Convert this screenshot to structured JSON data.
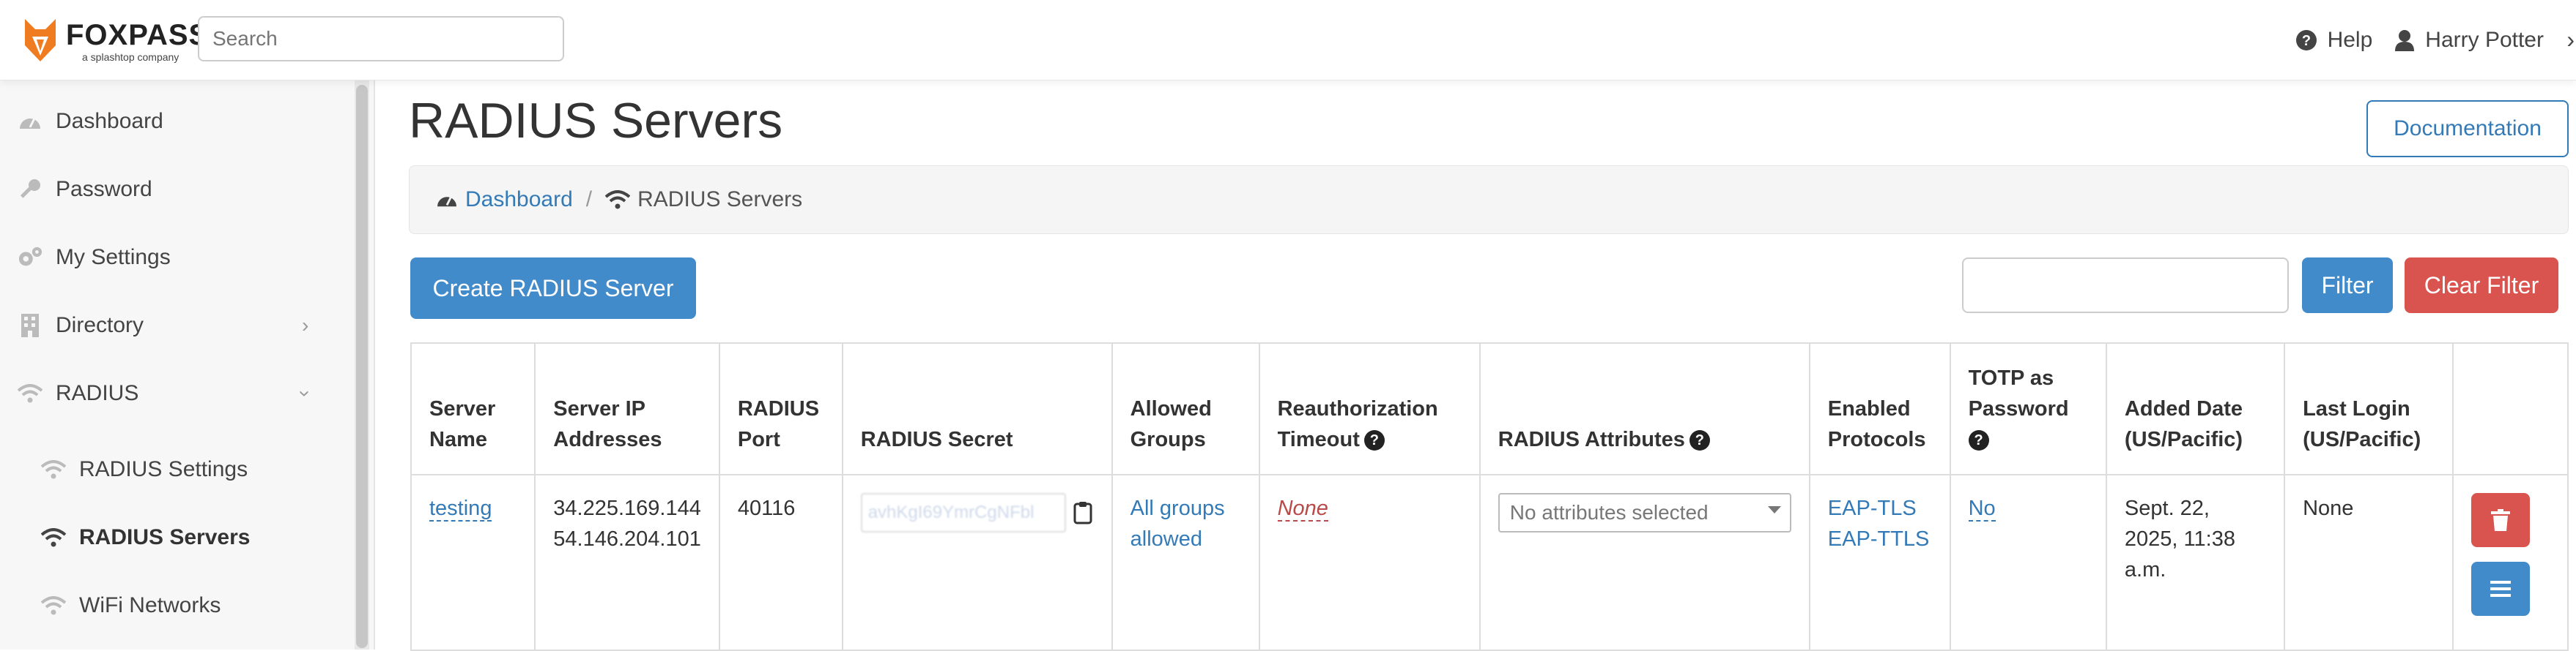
{
  "header": {
    "logo_text": "FOXPASS",
    "logo_subtext": "a splashtop company",
    "search_placeholder": "Search",
    "help_label": "Help",
    "user_name": "Harry Potter"
  },
  "sidebar": {
    "items": [
      {
        "label": "Dashboard",
        "icon": "dashboard-icon"
      },
      {
        "label": "Password",
        "icon": "key-icon"
      },
      {
        "label": "My Settings",
        "icon": "gears-icon"
      },
      {
        "label": "Directory",
        "icon": "building-icon"
      },
      {
        "label": "RADIUS",
        "icon": "wifi-icon"
      },
      {
        "label": "RADIUS Settings",
        "icon": "wifi-icon"
      },
      {
        "label": "RADIUS Servers",
        "icon": "wifi-icon"
      },
      {
        "label": "WiFi Networks",
        "icon": "wifi-icon"
      }
    ]
  },
  "main": {
    "title": "RADIUS Servers",
    "documentation_label": "Documentation",
    "breadcrumb": {
      "home": "Dashboard",
      "separator": "/",
      "current": "RADIUS Servers"
    },
    "create_label": "Create RADIUS Server",
    "filter_label": "Filter",
    "clear_filter_label": "Clear Filter",
    "table": {
      "headers": {
        "server_name": [
          "Server",
          "Name"
        ],
        "server_ip": [
          "Server IP",
          "Addresses"
        ],
        "port": [
          "RADIUS",
          "Port"
        ],
        "secret": "RADIUS Secret",
        "groups": [
          "Allowed",
          "Groups"
        ],
        "reauth": [
          "Reauthorization",
          "Timeout"
        ],
        "attributes": "RADIUS Attributes",
        "protocols": [
          "Enabled",
          "Protocols"
        ],
        "totp": [
          "TOTP as",
          "Password"
        ],
        "added": [
          "Added Date",
          "(US/Pacific)"
        ],
        "last_login": [
          "Last Login",
          "(US/Pacific)"
        ]
      },
      "rows": [
        {
          "server_name": "testing",
          "ip_1": "34.225.169.144",
          "ip_2": "54.146.204.101",
          "port": "40116",
          "secret": "avhKgI69YmrCgNFbl",
          "groups_1": "All groups",
          "groups_2": "allowed",
          "reauth": "None",
          "attributes_placeholder": "No attributes selected",
          "protocol_1": "EAP-TLS",
          "protocol_2": "EAP-TTLS",
          "totp": "No",
          "added_1": "Sept. 22,",
          "added_2": "2025, 11:38",
          "added_3": "a.m.",
          "last_login": "None"
        }
      ]
    }
  }
}
